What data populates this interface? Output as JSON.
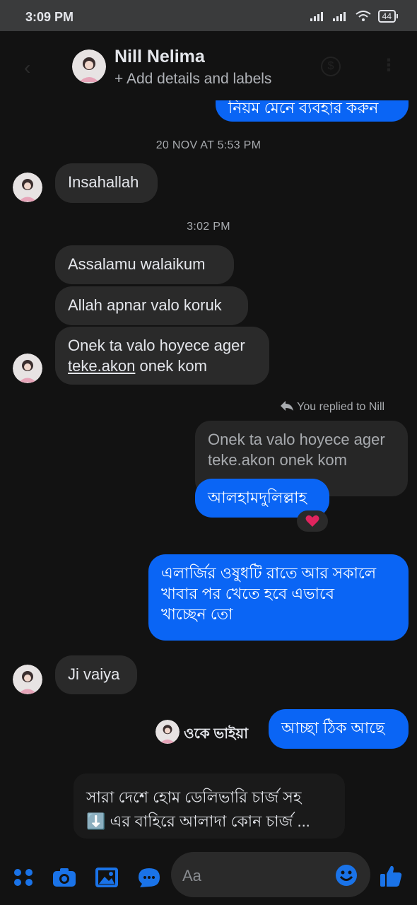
{
  "status": {
    "time": "3:09 PM",
    "battery": "44"
  },
  "header": {
    "name": "Nill Nelima",
    "subtitle": "+ Add details and labels"
  },
  "messages": {
    "top_partial": "নিয়ম মেনে ব্যবহার করুন",
    "ts1": "20 NOV AT 5:53 PM",
    "m1": "Insahallah",
    "ts2": "3:02 PM",
    "m2": "Assalamu walaikum",
    "m3": "Allah apnar valo koruk",
    "m4_line1": "Onek ta valo hoyece ager",
    "m4_line2_link": "teke.akon",
    "m4_line2_rest": " onek kom",
    "reply_label": "You replied to Nill",
    "quoted_line1": "Onek ta valo hoyece ager",
    "quoted_line2": "teke.akon onek kom",
    "out1": "আলহামদুলিল্লাহ",
    "out2_line1": "এলার্জির ওষুধটি রাতে আর সকালে",
    "out2_line2": "খাবার পর খেতে হবে এভাবে",
    "out2_line3": "খাচ্ছেন তো",
    "m5": "Ji vaiya",
    "seen_text": "ওকে ভাইয়া",
    "out3": "আচ্ছা ঠিক আছে"
  },
  "preview": {
    "line1": "সারা দেশে হোম ডেলিভারি চার্জ সহ",
    "line2": "⬇️ এর বাহিরে আলাদা কোন চার্জ ..."
  },
  "composer": {
    "placeholder": "Aa"
  },
  "colors": {
    "accent": "#0a65f5",
    "incoming": "#2a2a2a",
    "background": "#121212"
  },
  "icons": [
    "back-icon",
    "dollar-icon",
    "more-icon",
    "menu-icon",
    "camera-icon",
    "gallery-icon",
    "chat-icon",
    "emoji-icon",
    "like-icon",
    "reply-icon",
    "heart-icon"
  ]
}
